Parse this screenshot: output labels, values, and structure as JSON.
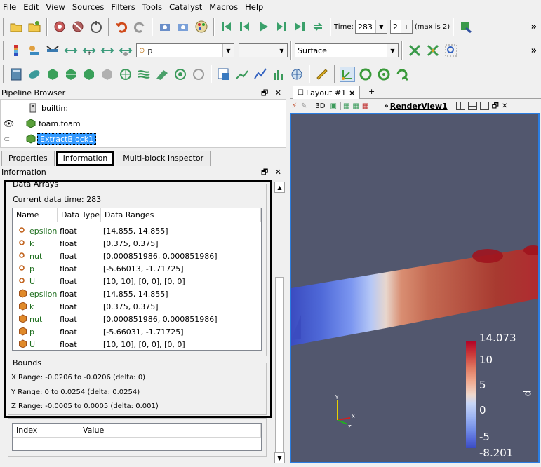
{
  "menu": [
    "File",
    "Edit",
    "View",
    "Sources",
    "Filters",
    "Tools",
    "Catalyst",
    "Macros",
    "Help"
  ],
  "toolbar": {
    "time_label": "Time:",
    "time_value": "283",
    "index_value": "2",
    "max_label": "(max is 2)",
    "variable": "p",
    "component": "",
    "representation": "Surface"
  },
  "pipeline": {
    "title": "Pipeline Browser",
    "items": [
      {
        "label": "builtin:"
      },
      {
        "label": "foam.foam"
      },
      {
        "label": "ExtractBlock1"
      }
    ]
  },
  "tabs": [
    "Properties",
    "Information",
    "Multi-block Inspector"
  ],
  "info": {
    "title": "Information",
    "data_arrays_label": "Data Arrays",
    "current_time": "Current data time: 283",
    "columns": [
      "Name",
      "Data Type",
      "Data Ranges"
    ],
    "rows": [
      {
        "name": "epsilon",
        "type": "float",
        "range": "[14.855, 14.855]",
        "kind": "point"
      },
      {
        "name": "k",
        "type": "float",
        "range": "[0.375, 0.375]",
        "kind": "point"
      },
      {
        "name": "nut",
        "type": "float",
        "range": "[0.000851986, 0.000851986]",
        "kind": "point"
      },
      {
        "name": "p",
        "type": "float",
        "range": "[-5.66013, -1.71725]",
        "kind": "point"
      },
      {
        "name": "U",
        "type": "float",
        "range": "[10, 10], [0, 0], [0, 0]",
        "kind": "point"
      },
      {
        "name": "epsilon",
        "type": "float",
        "range": "[14.855, 14.855]",
        "kind": "cell"
      },
      {
        "name": "k",
        "type": "float",
        "range": "[0.375, 0.375]",
        "kind": "cell"
      },
      {
        "name": "nut",
        "type": "float",
        "range": "[0.000851986, 0.000851986]",
        "kind": "cell"
      },
      {
        "name": "p",
        "type": "float",
        "range": "[-5.66031, -1.71725]",
        "kind": "cell"
      },
      {
        "name": "U",
        "type": "float",
        "range": "[10, 10], [0, 0], [0, 0]",
        "kind": "cell"
      }
    ],
    "bounds_label": "Bounds",
    "x_range": "X Range:  -0.0206 to -0.0206 (delta: 0)",
    "y_range": "Y Range:  0 to 0.0254 (delta: 0.0254)",
    "z_range": "Z Range:  -0.0005 to 0.0005 (delta: 0.001)",
    "kv_columns": [
      "Index",
      "Value"
    ]
  },
  "layout": {
    "tab_label": "Layout #1",
    "close": "×",
    "add": "+",
    "mode_3d": "3D",
    "render_view_label": "RenderView1",
    "arrows": "»"
  },
  "colorbar": {
    "title": "p",
    "ticks": [
      "14.073",
      "10",
      "5",
      "0",
      "-5",
      "-8.201"
    ]
  },
  "colors": {
    "background": "#52576e",
    "accent": "#2a7de1",
    "bar_high": "#b40426",
    "bar_low": "#3b4cc0"
  }
}
